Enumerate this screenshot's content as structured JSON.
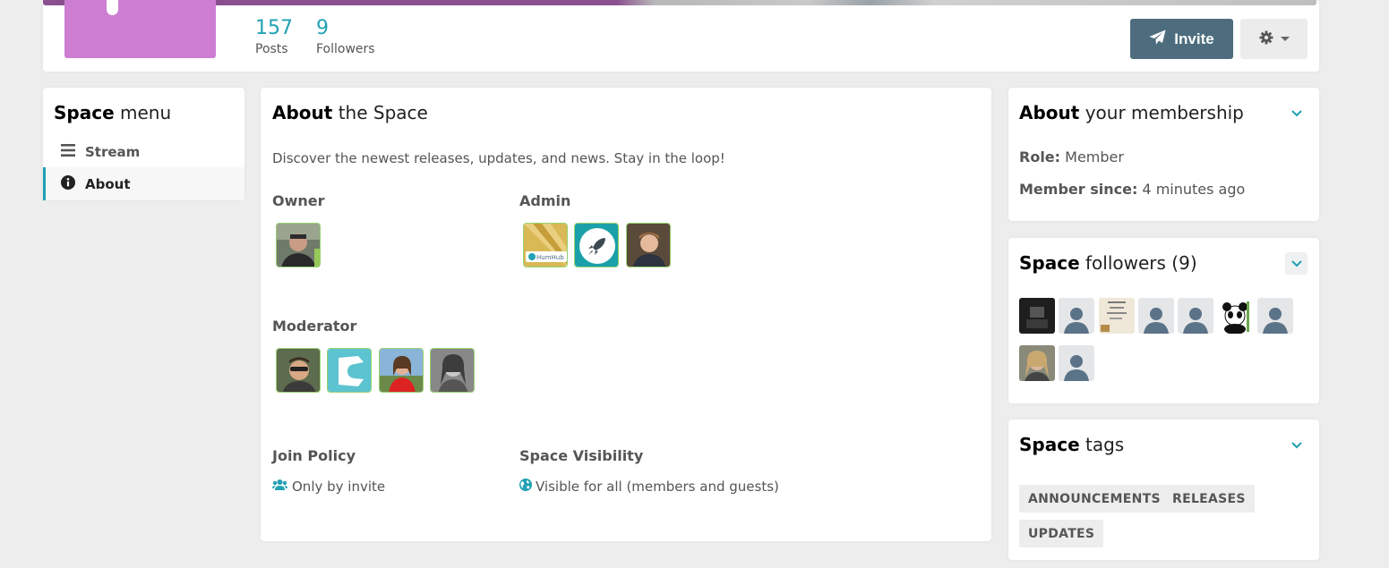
{
  "header": {
    "stats": [
      {
        "value": "157",
        "label": "Posts"
      },
      {
        "value": "9",
        "label": "Followers"
      }
    ],
    "invite_label": "Invite",
    "space_color": "#cd7ed2",
    "invite_color": "#4d6d7f"
  },
  "menu": {
    "title_bold": "Space",
    "title_rest": " menu",
    "items": [
      {
        "label": "Stream",
        "icon": "bars-icon"
      },
      {
        "label": "About",
        "icon": "info-circle-icon"
      }
    ]
  },
  "about": {
    "title_bold": "About",
    "title_rest": " the Space",
    "description": "Discover the newest releases, updates, and news. Stay in the loop!",
    "owner_label": "Owner",
    "admin_label": "Admin",
    "moderator_label": "Moderator",
    "join_policy_label": "Join Policy",
    "join_policy_value": "Only by invite",
    "visibility_label": "Space Visibility",
    "visibility_value": "Visible for all (members and guests)",
    "admin_logo_text": "HumHub"
  },
  "membership": {
    "title_bold": "About",
    "title_rest": " your membership",
    "role_label": "Role:",
    "role_value": " Member",
    "since_label": "Member since:",
    "since_value": " 4 minutes ago"
  },
  "followers": {
    "title_bold": "Space",
    "title_rest": " followers (9)"
  },
  "tags": {
    "title_bold": "Space",
    "title_rest": " tags",
    "items": [
      "ANNOUNCEMENTS",
      "RELEASES",
      "UPDATES"
    ]
  }
}
